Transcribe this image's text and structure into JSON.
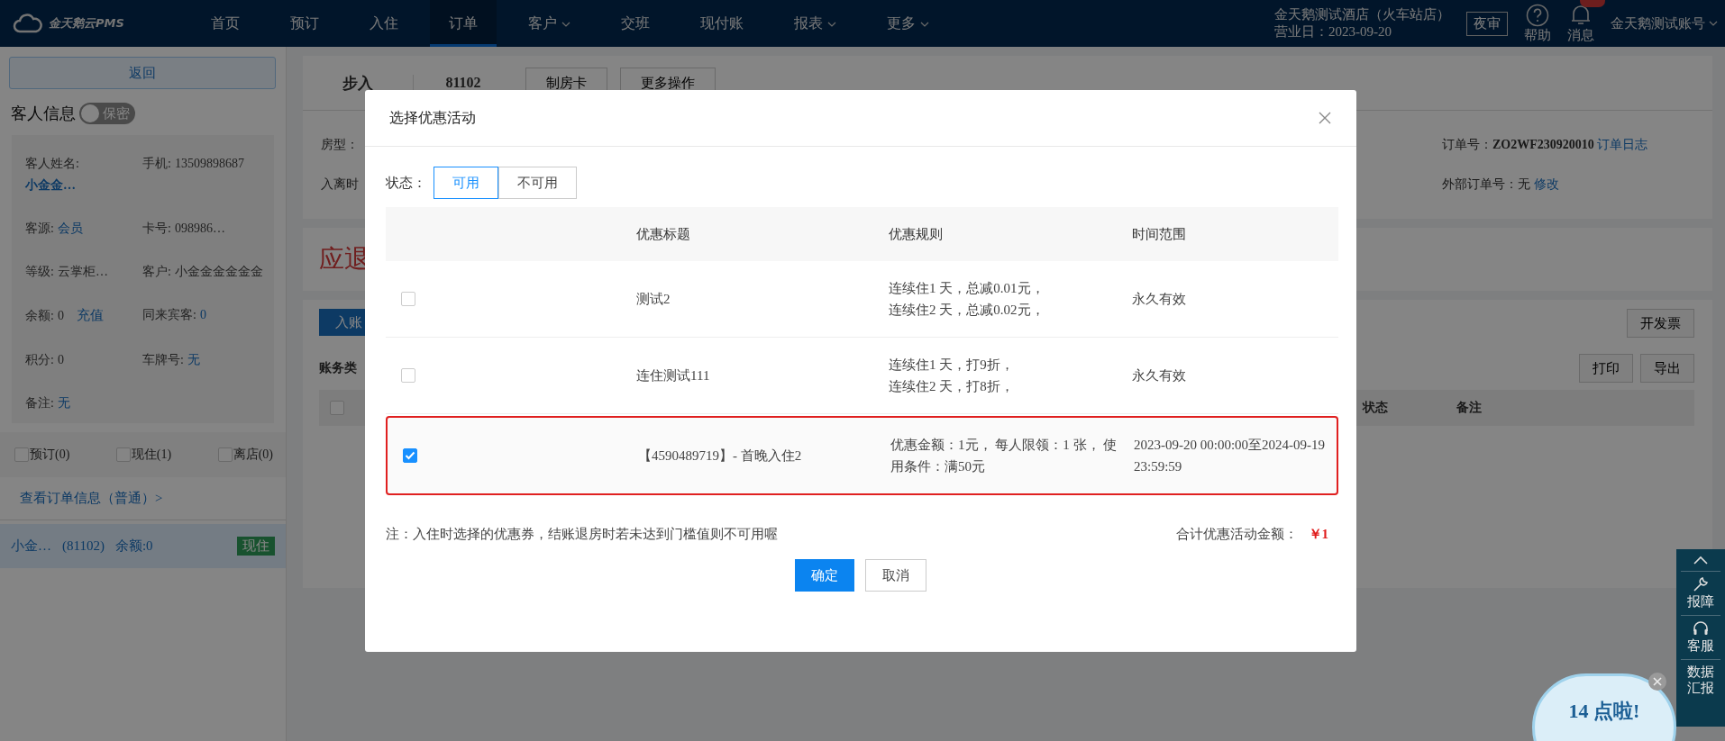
{
  "nav": {
    "logo": "金天鹅云PMS",
    "items": [
      {
        "label": "首页",
        "selected": false,
        "dropdown": false
      },
      {
        "label": "预订",
        "selected": false,
        "dropdown": false
      },
      {
        "label": "入住",
        "selected": false,
        "dropdown": false
      },
      {
        "label": "订单",
        "selected": true,
        "dropdown": false
      },
      {
        "label": "客户",
        "selected": false,
        "dropdown": true
      },
      {
        "label": "交班",
        "selected": false,
        "dropdown": false
      },
      {
        "label": "现付账",
        "selected": false,
        "dropdown": false
      },
      {
        "label": "报表",
        "selected": false,
        "dropdown": true
      },
      {
        "label": "更多",
        "selected": false,
        "dropdown": true
      }
    ],
    "hotel": "金天鹅测试酒店（火车站店）",
    "business_date": "营业日：2023-09-20",
    "night_audit": "夜审",
    "help": "帮助",
    "messages": "消息",
    "account": "金天鹅测试账号"
  },
  "sidebar": {
    "back": "返回",
    "guest_info_title": "客人信息",
    "privacy_toggle": {
      "label": "保密",
      "on": false
    },
    "fields": [
      {
        "label": "客人姓名:",
        "value": "小金金…",
        "kind": "link-block"
      },
      {
        "label": "手机:",
        "value": "13509898687",
        "kind": "text"
      },
      {
        "label": "客源:",
        "value": "会员",
        "kind": "link"
      },
      {
        "label": "卡号:",
        "value": "098986…",
        "kind": "text"
      },
      {
        "label": "等级:",
        "value": "云掌柜…",
        "kind": "text"
      },
      {
        "label": "客户:",
        "value": "小金金金金金金",
        "kind": "text"
      },
      {
        "label": "余额:",
        "value": "0",
        "kind": "text",
        "action": "充值"
      },
      {
        "label": "同来宾客:",
        "value": "0",
        "kind": "link"
      },
      {
        "label": "积分:",
        "value": "0",
        "kind": "text"
      },
      {
        "label": "车牌号:",
        "value": "无",
        "kind": "link"
      },
      {
        "label": "备注:",
        "value": "无",
        "kind": "link"
      }
    ],
    "filters": [
      {
        "label": "预订(0)",
        "checked": false
      },
      {
        "label": "现住(1)",
        "checked": false
      },
      {
        "label": "离店(0)",
        "checked": false
      }
    ],
    "order_link": "查看订单信息（普通）>",
    "room": {
      "name": "小金…",
      "room": "(81102)",
      "balance": "余额:0",
      "status": "现住"
    }
  },
  "order": {
    "status": "步入",
    "room": "81102",
    "actions": [
      "制房卡",
      "更多操作"
    ],
    "room_type_label": "房型：",
    "dates_label": "入离时",
    "order_no_label": "订单号：",
    "order_no": "ZO2WF230920010",
    "order_log": "订单日志",
    "external_label": "外部订单号：",
    "external_value": "无",
    "external_edit": "修改",
    "refund_label": "应退",
    "post_button": "入账",
    "invoice_button": "开发票",
    "account_type_label": "账务类",
    "print_button": "打印",
    "export_button": "导出",
    "select_all_checked": false,
    "columns": [
      "状态",
      "备注"
    ]
  },
  "modal": {
    "title": "选择优惠活动",
    "status_label": "状态：",
    "status_tabs": [
      {
        "label": "可用",
        "selected": true
      },
      {
        "label": "不可用",
        "selected": false
      }
    ],
    "columns": [
      "优惠标题",
      "优惠规则",
      "时间范围"
    ],
    "rows": [
      {
        "checked": false,
        "title": "测试2",
        "rules": [
          "连续住1 天，总减0.01元，",
          "连续住2 天，总减0.02元，"
        ],
        "time": "永久有效"
      },
      {
        "checked": false,
        "title": "连住测试111",
        "rules": [
          "连续住1 天，打9折，",
          "连续住2 天，打8折，"
        ],
        "time": "永久有效"
      },
      {
        "checked": true,
        "title": "【4590489719】- 首晚入住2",
        "rules": [
          "优惠金额：1元， 每人限领：1 张， 使用条件：满50元"
        ],
        "time": "2023-09-20 00:00:00至2024-09-19 23:59:59"
      }
    ],
    "note": "注：入住时选择的优惠券，结账退房时若未达到门槛值则不可用喔",
    "total_label": "合计优惠活动金额：",
    "total": "￥1",
    "confirm": "确定",
    "cancel": "取消"
  },
  "float_bar": {
    "items": [
      {
        "label": "报障",
        "kind": "wrench"
      },
      {
        "label": "客服",
        "kind": "headset"
      },
      {
        "label": "数据汇报",
        "kind": "text"
      }
    ]
  },
  "bubble": {
    "text": "14 点啦!"
  }
}
